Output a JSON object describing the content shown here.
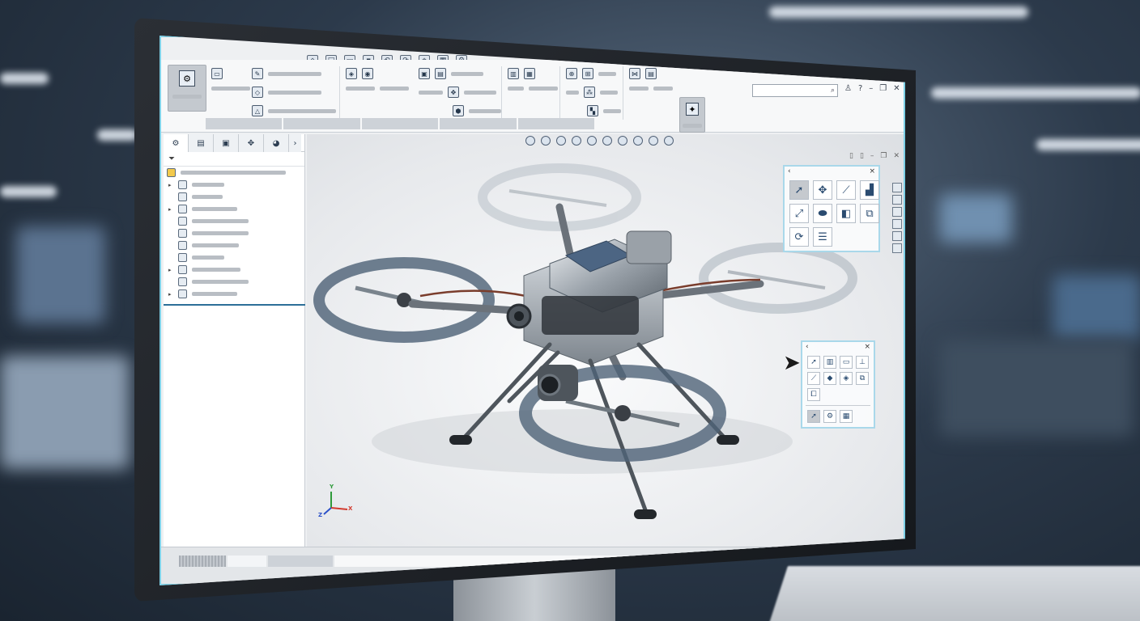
{
  "app": {
    "quick_access": [
      "home-icon",
      "new-icon",
      "open-icon",
      "save-icon",
      "undo-icon",
      "redo-icon",
      "select-icon",
      "rebuild-icon",
      "options-icon"
    ],
    "search": {
      "placeholder": "",
      "icon": "search-icon"
    },
    "window_controls": [
      "help-icon",
      "user-icon",
      "minimize-icon",
      "restore-icon",
      "close-icon"
    ]
  },
  "ribbon": {
    "groups": [
      {
        "id": "open",
        "icon": "folder-icon"
      },
      {
        "id": "sketch",
        "icon": "sketch-icon"
      },
      {
        "id": "features",
        "icon": "feature-icon"
      },
      {
        "id": "assembly",
        "icon": "assembly-icon"
      },
      {
        "id": "evaluate",
        "icon": "evaluate-icon"
      },
      {
        "id": "render",
        "icon": "render-icon"
      }
    ]
  },
  "tree": {
    "tabs": [
      "feature-manager-icon",
      "property-manager-icon",
      "configuration-icon",
      "dimxpert-icon",
      "display-icon"
    ],
    "expand_glyph": "›",
    "filter_icon": "funnel-icon",
    "rows": [
      {
        "expandable": true
      },
      {
        "expandable": false
      },
      {
        "expandable": true
      },
      {
        "expandable": false
      },
      {
        "expandable": false
      },
      {
        "expandable": false
      },
      {
        "expandable": false
      },
      {
        "expandable": true
      },
      {
        "expandable": false
      },
      {
        "expandable": true
      }
    ]
  },
  "triad": {
    "x": "X",
    "y": "Y",
    "z": "Z"
  },
  "palette_top": {
    "back_glyph": "‹",
    "close_glyph": "×",
    "tools": [
      "select-arrow-icon",
      "move-icon",
      "smart-dimension-icon",
      "sketch-plane-icon",
      "zoom-fit-icon",
      "solid-box-icon",
      "section-icon",
      "view-orientation-icon",
      "rotate-icon",
      "stack-icon"
    ]
  },
  "palette_bottom": {
    "back_glyph": "‹",
    "close_glyph": "×",
    "tools": [
      "pointer-icon",
      "table-icon",
      "window-icon",
      "mate-icon",
      "line-icon",
      "shape-icon",
      "rotate-component-icon",
      "move-component-icon",
      "copy-icon",
      "select-tool-icon",
      "component-icon",
      "grid-icon"
    ]
  },
  "colors": {
    "accent": "#7ed0e6",
    "tree_split": "#2d6f98",
    "selected_tool": "#c5c9ce"
  }
}
